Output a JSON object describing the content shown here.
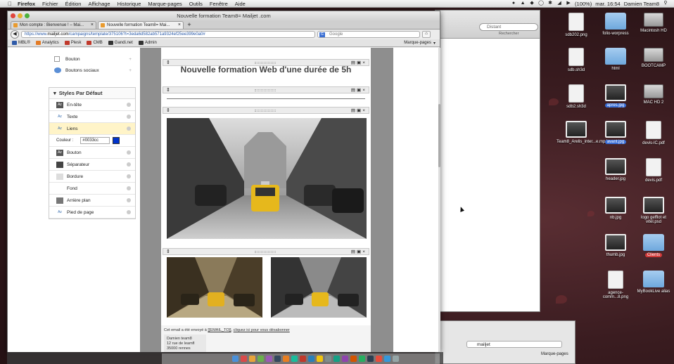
{
  "menubar": {
    "app": "Firefox",
    "items": [
      "Fichier",
      "Édition",
      "Affichage",
      "Historique",
      "Marque-pages",
      "Outils",
      "Fenêtre",
      "Aide"
    ],
    "clock": "mar. 16:54",
    "user": "Damien Team8",
    "battery": "(100%)"
  },
  "window": {
    "title": "Nouvelle formation Team8= Mailjet .com",
    "tabs": [
      {
        "label": "Mon compte : Bienvenue ! – Mai...",
        "active": false
      },
      {
        "label": "Nouvelle formation Team8= Mai...",
        "active": true
      }
    ],
    "url_prefix": "https://www.",
    "url_host": "mailjet.com",
    "url_rest": "/campaigns/template/375106?t=3eda6d582ab571a9324ef25ee399e0a0#",
    "search_placeholder": "Google",
    "bookmarks": [
      "MBL®",
      "Analytics",
      "Plesk",
      "CMB",
      "Gandi.net",
      "Admin"
    ],
    "bookmarks_menu": "Marque-pages"
  },
  "editor_panel": {
    "rows_top": [
      "Bouton",
      "Boutons sociaux"
    ],
    "styles_header": "Styles Par Défaut",
    "styles": [
      "En-tête",
      "Texte",
      "Liens"
    ],
    "color_label": "Couleur :",
    "color_value": "#0033cc",
    "color_hex": "#0033cc",
    "styles_more": [
      "Bouton",
      "Séparateur",
      "Bordure",
      "Fond",
      "Arrière plan",
      "Pied de page"
    ]
  },
  "email": {
    "headline": "Nouvelle formation Web d'une durée de 5h",
    "footer_text": "Cet email a été envoyé à",
    "footer_email_tag": "[[EMAIL_TO]]",
    "footer_unsub": "cliquez ici pour vous désabonner",
    "footer_addr": [
      "Damien team8",
      "12 rue de leamfl",
      "35000 rennes"
    ]
  },
  "finder": {
    "search_placeholder": "Distant",
    "search_label": "Rechercher"
  },
  "ff2": {
    "search": "mailjet",
    "bookmarks_menu": "Marque-pages"
  },
  "desktop_icons": [
    {
      "label": "sdb202.png",
      "type": "doc"
    },
    {
      "label": "folio-worpress",
      "type": "folder"
    },
    {
      "label": "Macintosh HD",
      "type": "hd"
    },
    {
      "label": "sdb.sh3d",
      "type": "doc"
    },
    {
      "label": "html",
      "type": "folder"
    },
    {
      "label": "BOOTCAMP",
      "type": "hd"
    },
    {
      "label": "sdb2.sh3d",
      "type": "doc"
    },
    {
      "label": "apres.jpg",
      "type": "thumb"
    },
    {
      "label": "MAC HD 2",
      "type": "hd"
    },
    {
      "label": "Team8_Arelis_inter...e.mp4",
      "type": "thumb"
    },
    {
      "label": "avant.jpg",
      "type": "thumb"
    },
    {
      "label": "devis-lC.pdf",
      "type": "doc"
    },
    {
      "label": "header.jpg",
      "type": "thumb"
    },
    {
      "label": "devis.pdf",
      "type": "doc"
    },
    {
      "label": "nb.jpg",
      "type": "thumb"
    },
    {
      "label": "logo gefflot et vitel.psd",
      "type": "thumb"
    },
    {
      "label": "thumb.jpg",
      "type": "thumb"
    },
    {
      "label": "Clients",
      "type": "folder"
    },
    {
      "label": "agence-comm...8.png",
      "type": "doc"
    },
    {
      "label": "MyBookLive alias",
      "type": "folder"
    }
  ],
  "colors": {
    "accent": "#3a6fd8",
    "link_color": "#0033cc",
    "selected_row": "#fff4c8"
  }
}
